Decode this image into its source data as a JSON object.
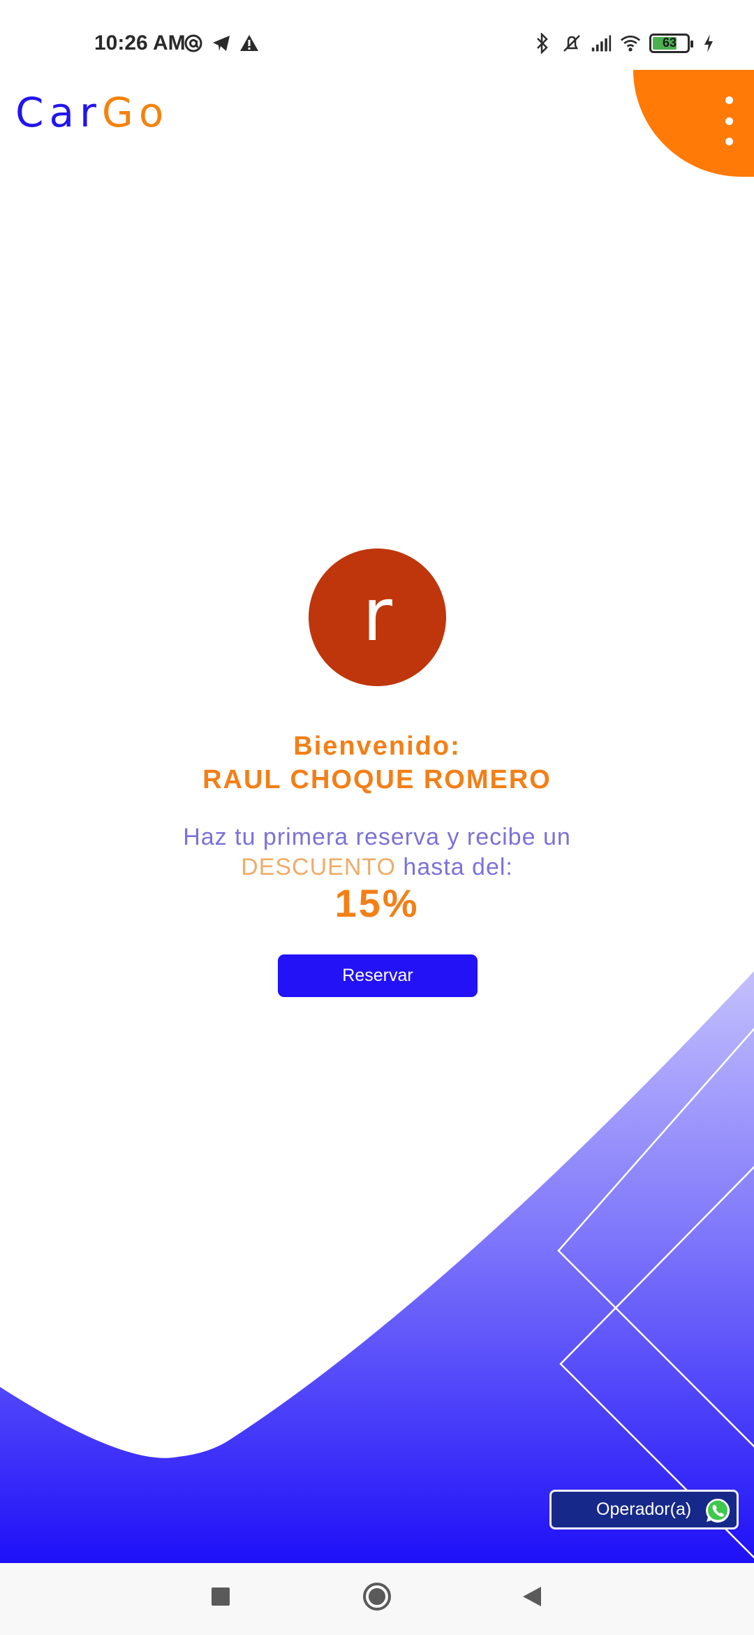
{
  "status_bar": {
    "time": "10:26 AM",
    "battery_level": "63",
    "left_icons": [
      "at-sign-icon",
      "telegram-icon",
      "warning-icon"
    ],
    "right_icons": [
      "bluetooth-icon",
      "mute-vibrate-icon",
      "signal-icon",
      "wifi-icon",
      "battery-icon",
      "charging-icon"
    ]
  },
  "header": {
    "logo_part1": "Car",
    "logo_part2": "Go",
    "menu_icon": "vertical-ellipsis-icon"
  },
  "profile": {
    "avatar_letter": "r",
    "avatar_color": "#bf360c"
  },
  "welcome": {
    "label": "Bienvenido:",
    "name": "RAUL CHOQUE ROMERO"
  },
  "promo": {
    "line1": "Haz tu primera reserva y recibe un",
    "highlight": "DESCUENTO",
    "line2_rest": " hasta del:",
    "discount": "15%"
  },
  "actions": {
    "reserve_label": "Reservar",
    "operator_label": "Operador(a)",
    "operator_icon": "whatsapp-icon"
  },
  "nav": {
    "recents_icon": "square-icon",
    "home_icon": "circle-icon",
    "back_icon": "triangle-back-icon"
  },
  "colors": {
    "brand_blue": "#2214ee",
    "brand_orange": "#f5820d",
    "button_blue": "#2212f5"
  }
}
